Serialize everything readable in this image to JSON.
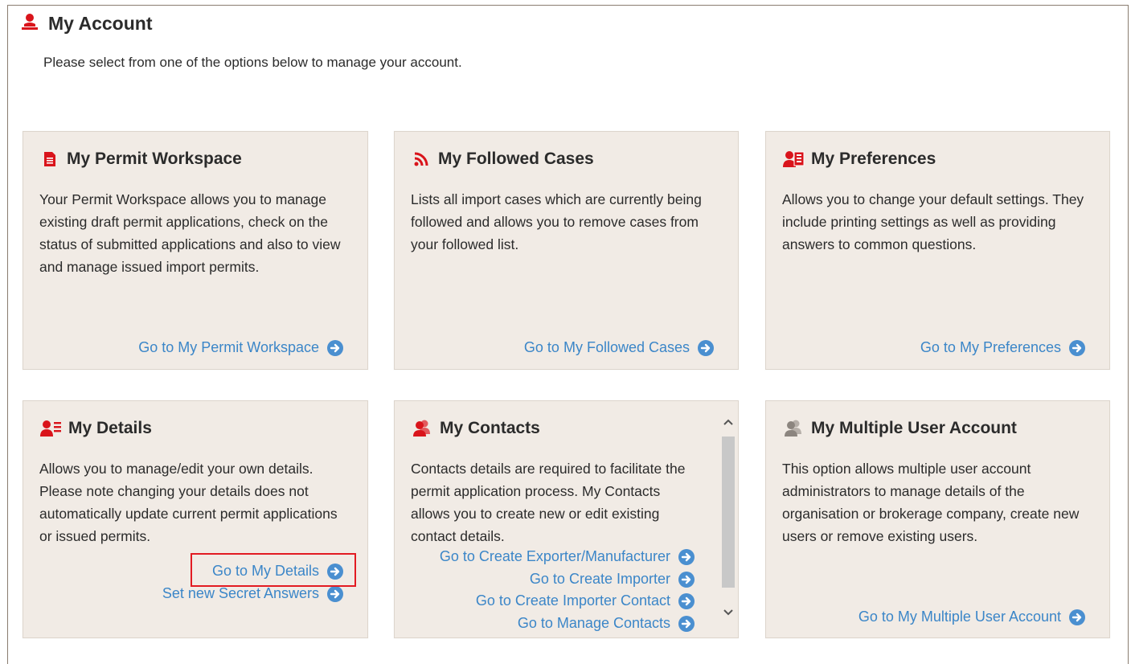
{
  "page": {
    "title": "My Account",
    "intro": "Please select from one of the options below to manage your account.",
    "icon": "user-icon",
    "accent_color": "#d9141b",
    "link_color": "#3b86c8"
  },
  "cards": {
    "workspace": {
      "title": "My Permit Workspace",
      "icon": "document-icon",
      "description": "Your Permit Workspace allows you to manage existing draft permit applications, check on the status of submitted applications and also to view and manage issued import permits.",
      "links": [
        "Go to My Permit Workspace"
      ]
    },
    "followed": {
      "title": "My Followed Cases",
      "icon": "rss-icon",
      "description": "Lists all import cases which are currently being followed and allows you to remove cases from your followed list.",
      "links": [
        "Go to My Followed Cases"
      ]
    },
    "preferences": {
      "title": "My Preferences",
      "icon": "user-settings-icon",
      "description": "Allows you to change your default settings. They include printing settings as well as providing answers to common questions.",
      "links": [
        "Go to My Preferences"
      ]
    },
    "details": {
      "title": "My Details",
      "icon": "user-details-icon",
      "description": "Allows you to manage/edit your own details. Please note changing your details does not automatically update current permit applications or issued permits.",
      "links": [
        "Go to My Details",
        "Set new Secret Answers"
      ]
    },
    "contacts": {
      "title": "My Contacts",
      "icon": "contacts-icon",
      "description": "Contacts details are required to facilitate the permit application process. My Contacts allows you to create new or edit existing contact details.",
      "links": [
        "Go to Create Exporter/Manufacturer",
        "Go to Create Importer",
        "Go to Create Importer Contact",
        "Go to Manage Contacts"
      ]
    },
    "multi_user": {
      "title": "My Multiple User Account",
      "icon": "multi-user-icon",
      "description": "This option allows multiple user account administrators to manage details of the organisation or brokerage company, create new users or remove existing users.",
      "links": [
        "Go to My Multiple User Account"
      ]
    }
  }
}
